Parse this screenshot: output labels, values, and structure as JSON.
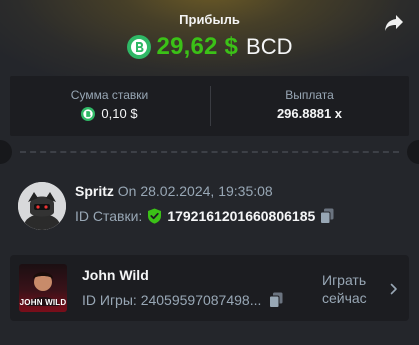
{
  "header": {
    "title": "Прибыль",
    "amount": "29,62 $",
    "currency": "BCD",
    "amount_color": "#3bc117",
    "share_icon": "share-arrow-icon",
    "coin_icon": "bcd-coin-icon"
  },
  "stats": {
    "bet_label": "Сумма ставки",
    "bet_value": "0,10 $",
    "payout_label": "Выплата",
    "payout_value": "296.8881 x"
  },
  "user": {
    "name": "Spritz",
    "time": "On 28.02.2024, 19:35:08",
    "bet_id_label": "ID Ставки:",
    "bet_id": "1792161201660806185"
  },
  "game": {
    "name": "John Wild",
    "thumb_text": "JOHN WILD",
    "id_label": "ID Игры:",
    "id_value": "24059597087498...",
    "play_label": "Играть сейчас"
  }
}
